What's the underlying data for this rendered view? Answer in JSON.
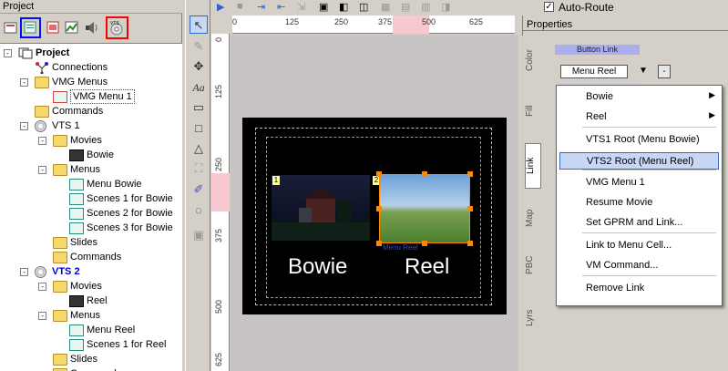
{
  "project_panel": {
    "title": "Project",
    "tree": [
      {
        "label": "Project",
        "bold": true
      },
      {
        "label": "Connections"
      },
      {
        "label": "VMG Menus"
      },
      {
        "label": "VMG Menu 1"
      },
      {
        "label": "Commands"
      },
      {
        "label": "VTS 1"
      },
      {
        "label": "Movies"
      },
      {
        "label": "Bowie"
      },
      {
        "label": "Menus"
      },
      {
        "label": "Menu Bowie"
      },
      {
        "label": "Scenes 1 for Bowie"
      },
      {
        "label": "Scenes 2 for Bowie"
      },
      {
        "label": "Scenes 3 for Bowie"
      },
      {
        "label": "Slides"
      },
      {
        "label": "Commands"
      },
      {
        "label": "VTS 2",
        "bold": true,
        "color": "#0000cc"
      },
      {
        "label": "Movies"
      },
      {
        "label": "Reel"
      },
      {
        "label": "Menus"
      },
      {
        "label": "Menu Reel"
      },
      {
        "label": "Scenes 1 for Reel"
      },
      {
        "label": "Slides"
      },
      {
        "label": "Commands"
      }
    ]
  },
  "toolbar": {
    "auto_route_label": "Auto-Route",
    "auto_route_checked": true
  },
  "ruler": {
    "top_ticks": [
      "0",
      "125",
      "250",
      "375",
      "500",
      "625"
    ],
    "left_ticks": [
      "0",
      "125",
      "250",
      "375",
      "500",
      "625"
    ]
  },
  "menu_preview": {
    "button1_number": "1",
    "button2_number": "2",
    "button2_link_label": "Menu Reel",
    "caption_left": "Bowie",
    "caption_right": "Reel"
  },
  "properties": {
    "title": "Properties",
    "section_label": "Button Link",
    "link_value": "Menu Reel",
    "clear_button": "-",
    "vtabs": [
      "Color",
      "Fill",
      "Link",
      "Map",
      "PBC",
      "Lyrs"
    ]
  },
  "context_menu": {
    "items": [
      {
        "label": "Bowie",
        "submenu": true
      },
      {
        "label": "Reel",
        "submenu": true
      },
      {
        "label": "VTS1 Root (Menu Bowie)"
      },
      {
        "label": "VTS2 Root (Menu Reel)",
        "highlighted": true
      },
      {
        "label": "VMG Menu 1"
      },
      {
        "label": "Resume Movie"
      },
      {
        "label": "Set GPRM and Link..."
      },
      {
        "label": "Link to Menu Cell..."
      },
      {
        "label": "VM Command..."
      },
      {
        "label": "Remove Link"
      }
    ]
  },
  "colors": {
    "highlight": "#c8d7f5",
    "highlight_border": "#316ac5",
    "selection_handle": "#ff8a00",
    "vts2_label": "#0000cc",
    "canvas_bg": "#c8c4c4"
  }
}
